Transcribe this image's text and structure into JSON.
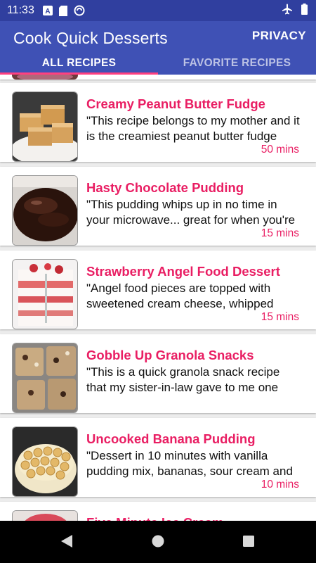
{
  "status_bar": {
    "time": "11:33",
    "icons": [
      "a-badge-icon",
      "sd-card-icon",
      "sync-icon",
      "airplane-icon",
      "battery-icon"
    ]
  },
  "app_bar": {
    "title": "Cook Quick Desserts",
    "privacy_label": "PRIVACY",
    "background": "#3F51B5"
  },
  "tabs": [
    {
      "label": "ALL RECIPES",
      "active": true
    },
    {
      "label": "FAVORITE RECIPES",
      "active": false
    }
  ],
  "accent_color": "#E91E63",
  "indicator_color": "#FF4081",
  "recipes": [
    {
      "title": "Creamy Peanut Butter Fudge",
      "description": "\"This recipe belongs to my mother and it is the creamiest peanut butter fudge",
      "time": "50 mins",
      "image": "peanut-butter-fudge-image"
    },
    {
      "title": "Hasty Chocolate Pudding",
      "description": "\"This pudding whips up in no time in your microwave... great for when you're",
      "time": "15 mins",
      "image": "chocolate-pudding-image"
    },
    {
      "title": "Strawberry Angel Food Dessert",
      "description": "\"Angel food pieces are topped with sweetened cream cheese, whipped",
      "time": "15 mins",
      "image": "strawberry-trifle-image"
    },
    {
      "title": "Gobble Up Granola Snacks",
      "description": "\"This is a quick granola snack recipe that my sister-in-law gave to me one",
      "time": "",
      "image": "granola-snacks-image"
    },
    {
      "title": "Uncooked Banana Pudding",
      "description": "\"Dessert in 10 minutes with vanilla pudding mix, bananas, sour cream and",
      "time": "10 mins",
      "image": "banana-pudding-image"
    },
    {
      "title": "Five Minute Ice Cream",
      "description": "",
      "time": "",
      "image": "ice-cream-image"
    }
  ],
  "nav_bar": {
    "buttons": [
      "back-icon",
      "home-icon",
      "recents-icon"
    ]
  }
}
